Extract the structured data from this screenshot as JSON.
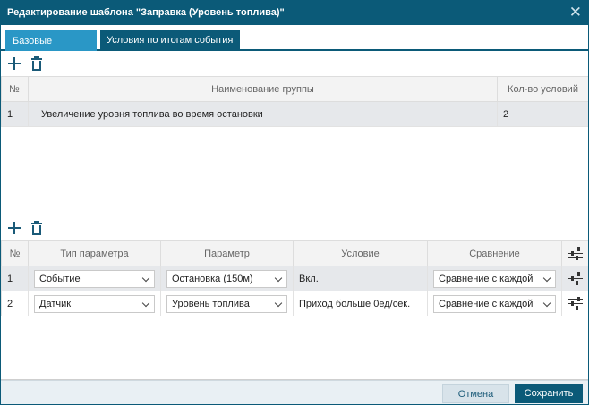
{
  "dialog": {
    "title": "Редактирование шаблона \"Заправка (Уровень топлива)\"",
    "close_symbol": "✕"
  },
  "tabs": [
    {
      "label": "Базовые условия",
      "active": true
    },
    {
      "label": "Условия по итогам события",
      "active": false
    }
  ],
  "toolbar": {
    "add_icon": "plus-icon",
    "delete_icon": "trash-icon"
  },
  "groups_table": {
    "columns": [
      "№",
      "Наименование группы",
      "Кол-во условий"
    ],
    "rows": [
      {
        "num": "1",
        "name": "Увеличение уровня топлива во время остановки",
        "count": "2"
      }
    ]
  },
  "conditions_table": {
    "columns": [
      "№",
      "Тип параметра",
      "Параметр",
      "Условие",
      "Сравнение"
    ],
    "settings_icon": "sliders-icon",
    "rows": [
      {
        "num": "1",
        "param_type": "Событие",
        "param": "Остановка (150м)",
        "condition": "Вкл.",
        "comparison": "Сравнение с каждой"
      },
      {
        "num": "2",
        "param_type": "Датчик",
        "param": "Уровень топлива",
        "condition": "Приход больше 0ед/сек.",
        "comparison": "Сравнение с каждой"
      }
    ]
  },
  "footer": {
    "cancel_label": "Отмена",
    "save_label": "Сохранить"
  },
  "colors": {
    "primary": "#0b5a78",
    "tab_active": "#2a97c6",
    "selected_row": "#e6e8eb"
  }
}
